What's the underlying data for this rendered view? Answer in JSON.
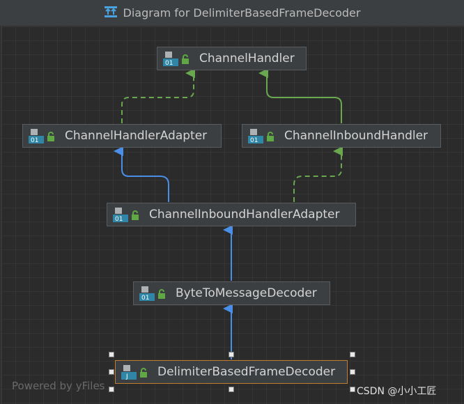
{
  "window": {
    "title": "Diagram for DelimiterBasedFrameDecoder"
  },
  "nodes": {
    "channel_handler": "ChannelHandler",
    "channel_handler_adapter": "ChannelHandlerAdapter",
    "channel_inbound_handler": "ChannelInboundHandler",
    "channel_inbound_handler_adapter": "ChannelInboundHandlerAdapter",
    "byte_to_message_decoder": "ByteToMessageDecoder",
    "delimiter_based_frame_decoder": "DelimiterBasedFrameDecoder"
  },
  "colors": {
    "extends_edge": "#4a8fe7",
    "implements_edge": "#6aa84f",
    "selected_border": "#c27d2f"
  },
  "footer": {
    "powered_by": "Powered by yFiles",
    "watermark": "CSDN @小小工匠"
  }
}
